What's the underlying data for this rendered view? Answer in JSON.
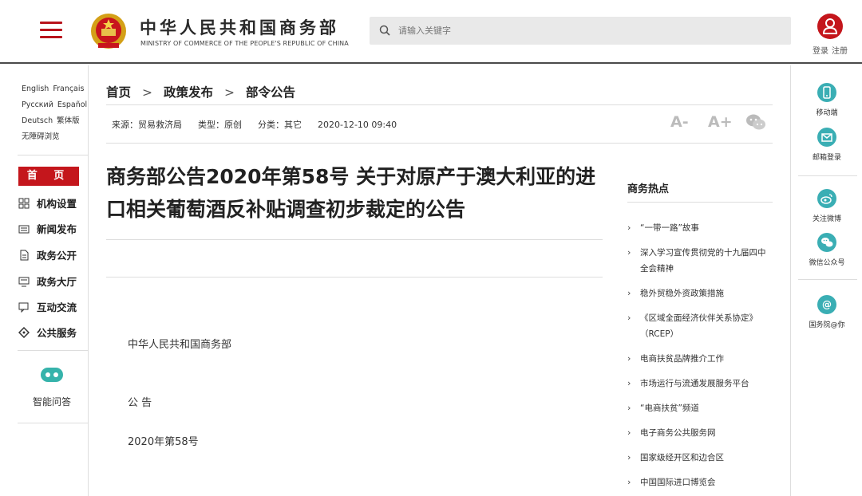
{
  "header": {
    "site_name_cn": "中华人民共和国商务部",
    "site_name_en": "MINISTRY OF COMMERCE OF THE PEOPLE'S REPUBLIC OF CHINA",
    "search_placeholder": "请输入关键字",
    "login": "登录",
    "register": "注册"
  },
  "languages": [
    "English",
    "Français",
    "Русский",
    "Español",
    "Deutsch",
    "繁体版",
    "无障碍浏览"
  ],
  "nav": {
    "home": "首 页",
    "items": [
      "机构设置",
      "新闻发布",
      "政务公开",
      "政务大厅",
      "互动交流",
      "公共服务"
    ],
    "qa": "智能问答"
  },
  "breadcrumb": [
    "首页",
    "政策发布",
    "部令公告"
  ],
  "meta": {
    "source": "来源：贸易救济局",
    "type": "类型：原创",
    "category": "分类：其它",
    "datetime": "2020-12-10 09:40"
  },
  "font_tools": [
    "A-",
    "A+"
  ],
  "article": {
    "title": "商务部公告2020年第58号 关于对原产于澳大利亚的进口相关葡萄酒反补贴调查初步裁定的公告",
    "para1": "中华人民共和国商务部",
    "para2": "公 告",
    "para3": "2020年第58号"
  },
  "hot": {
    "title": "商务热点",
    "items": [
      "“一带一路”故事",
      "深入学习宣传贯彻党的十九届四中全会精神",
      "稳外贸稳外资政策措施",
      "《区域全面经济伙伴关系协定》（RCEP）",
      "电商扶贫品牌推介工作",
      "市场运行与流通发展服务平台",
      "“电商扶贫”频道",
      "电子商务公共服务网",
      "国家级经开区和边合区",
      "中国国际进口博览会"
    ]
  },
  "right_bar": [
    "移动端",
    "邮箱登录",
    "关注微博",
    "微信公众号",
    "国务院@你"
  ],
  "colors": {
    "brand_red": "#c4161c",
    "teal": "#3aaeb4"
  }
}
